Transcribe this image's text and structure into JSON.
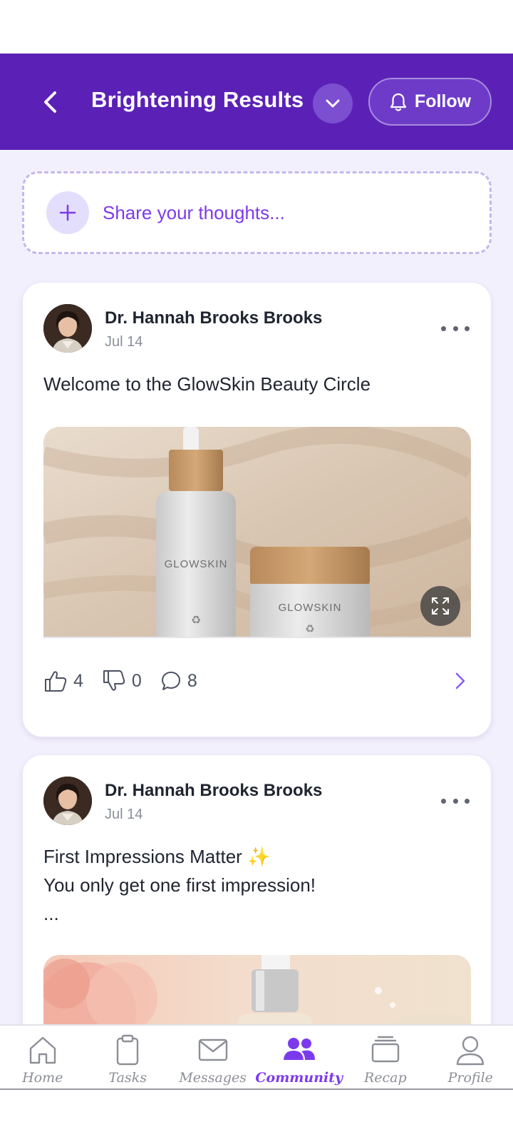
{
  "header": {
    "title": "Brightening Results",
    "follow_label": "Follow"
  },
  "composer": {
    "placeholder": "Share your thoughts..."
  },
  "posts": [
    {
      "author": "Dr. Hannah Brooks Brooks",
      "date": "Jul 14",
      "text": "Welcome to the GlowSkin Beauty Circle",
      "image_brand_text": "GLOWSKIN",
      "likes": "4",
      "dislikes": "0",
      "comments": "8"
    },
    {
      "author": "Dr. Hannah Brooks Brooks",
      "date": "Jul 14",
      "text_line1": "First Impressions Matter ✨",
      "text_line2": "You only get one first impression!",
      "text_line3": "..."
    }
  ],
  "nav": {
    "items": [
      {
        "label": "Home",
        "icon": "home-icon"
      },
      {
        "label": "Tasks",
        "icon": "clipboard-icon"
      },
      {
        "label": "Messages",
        "icon": "envelope-icon"
      },
      {
        "label": "Community",
        "icon": "people-icon",
        "active": true
      },
      {
        "label": "Recap",
        "icon": "stack-icon"
      },
      {
        "label": "Profile",
        "icon": "person-icon"
      }
    ]
  },
  "colors": {
    "header_bg": "#5b21b6",
    "accent": "#7c3aed",
    "feed_bg": "#f3f0fd"
  }
}
